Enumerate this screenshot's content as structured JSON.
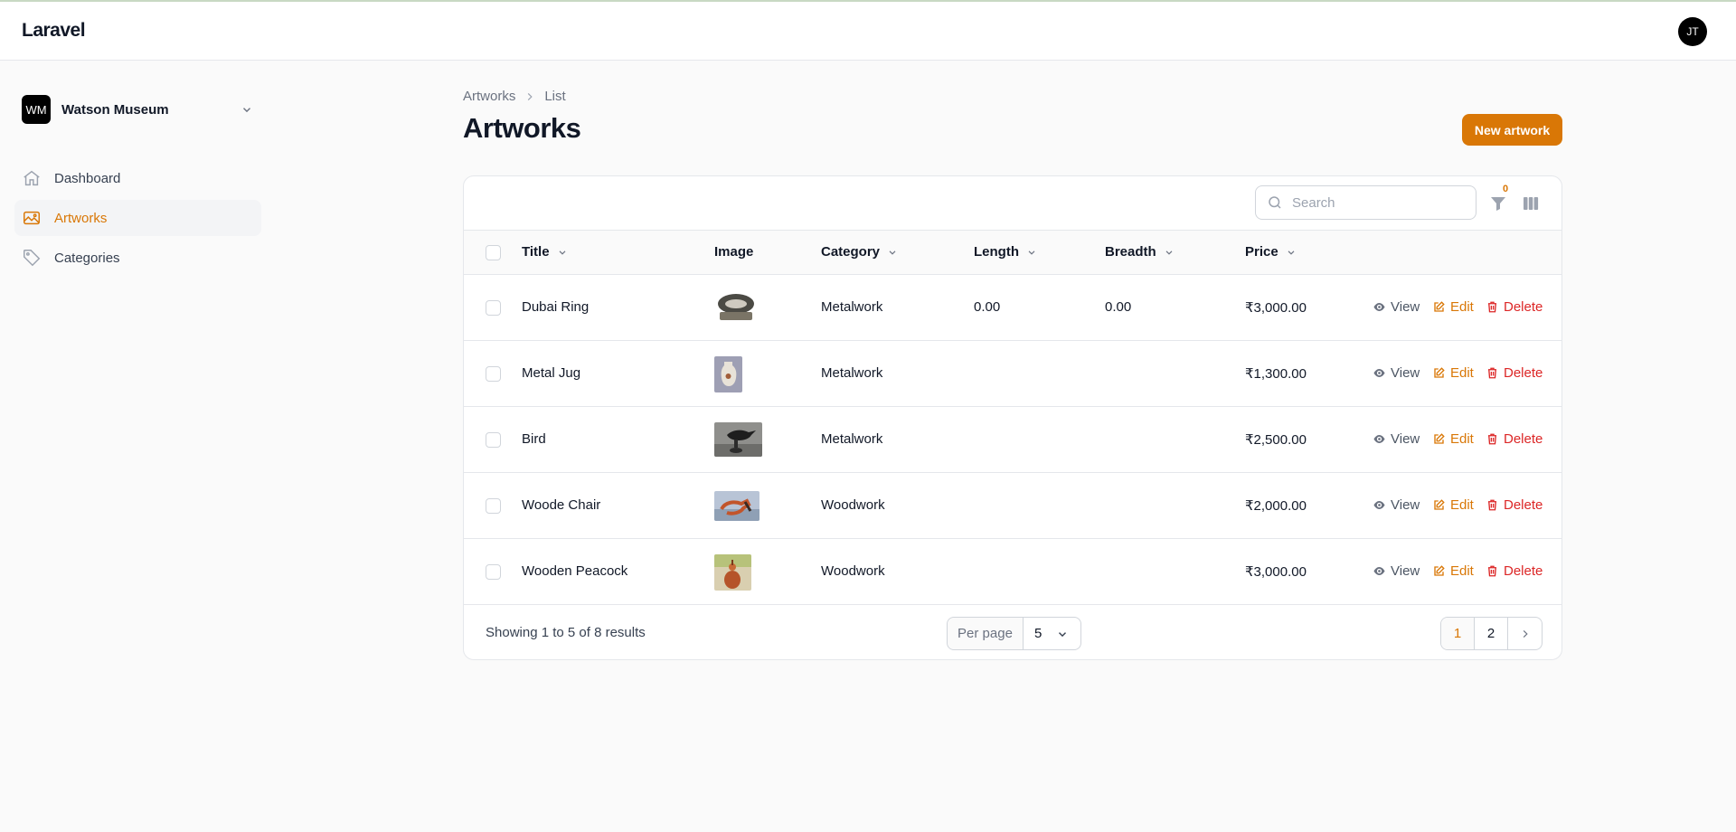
{
  "app": {
    "brand": "Laravel",
    "user_initials": "JT"
  },
  "tenant": {
    "initials": "WM",
    "name": "Watson Museum"
  },
  "nav": [
    {
      "label": "Dashboard",
      "icon": "home-icon",
      "active": false
    },
    {
      "label": "Artworks",
      "icon": "photo-icon",
      "active": true
    },
    {
      "label": "Categories",
      "icon": "tag-icon",
      "active": false
    }
  ],
  "breadcrumb": {
    "parent": "Artworks",
    "current": "List"
  },
  "page": {
    "title": "Artworks",
    "new_button": "New artwork"
  },
  "toolbar": {
    "search_placeholder": "Search",
    "filter_count": "0"
  },
  "columns": {
    "title": "Title",
    "image": "Image",
    "category": "Category",
    "length": "Length",
    "breadth": "Breadth",
    "price": "Price"
  },
  "actions": {
    "view": "View",
    "edit": "Edit",
    "delete": "Delete"
  },
  "rows": [
    {
      "title": "Dubai Ring",
      "category": "Metalwork",
      "length": "0.00",
      "breadth": "0.00",
      "price": "₹3,000.00",
      "image_desc": "metal ring"
    },
    {
      "title": "Metal Jug",
      "category": "Metalwork",
      "length": "",
      "breadth": "",
      "price": "₹1,300.00",
      "image_desc": "jug"
    },
    {
      "title": "Bird",
      "category": "Metalwork",
      "length": "",
      "breadth": "",
      "price": "₹2,500.00",
      "image_desc": "bird"
    },
    {
      "title": "Woode Chair",
      "category": "Woodwork",
      "length": "",
      "breadth": "",
      "price": "₹2,000.00",
      "image_desc": "chair"
    },
    {
      "title": "Wooden Peacock",
      "category": "Woodwork",
      "length": "",
      "breadth": "",
      "price": "₹3,000.00",
      "image_desc": "peacock"
    }
  ],
  "footer": {
    "results": "Showing 1 to 5 of 8 results",
    "per_page_label": "Per page",
    "per_page_value": "5",
    "pages": [
      "1",
      "2"
    ],
    "current_page": "1"
  },
  "colors": {
    "accent": "#d97706",
    "danger": "#dc2626"
  }
}
